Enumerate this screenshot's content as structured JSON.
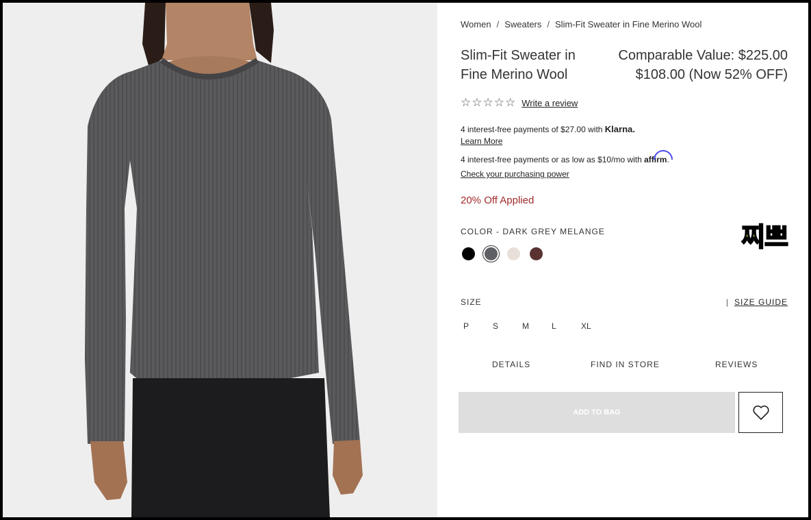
{
  "breadcrumb": {
    "items": [
      "Women",
      "Sweaters",
      "Slim-Fit Sweater in Fine Merino Wool"
    ],
    "separator": "/"
  },
  "product": {
    "name": "Slim-Fit Sweater in Fine Merino Wool",
    "comparable_value": "Comparable Value: $225.00",
    "sale_price": "$108.00 (Now 52% OFF)"
  },
  "rating": {
    "stars": "☆☆☆☆☆",
    "write_review": "Write a review"
  },
  "payments": {
    "klarna_text": "4 interest-free payments of $27.00 with ",
    "klarna_brand": "Klarna.",
    "klarna_link": "Learn More",
    "affirm_text": "4 interest-free payments or as low as $10/mo with ",
    "affirm_brand": "affirm",
    "affirm_suffix": ".",
    "affirm_link": "Check your purchasing power"
  },
  "discount_note": "20% Off Applied",
  "color": {
    "label": "COLOR -  DARK GREY MELANGE",
    "swatches": [
      {
        "name": "Black",
        "hex": "#000000"
      },
      {
        "name": "Dark Grey Melange",
        "hex": "#5f5f66"
      },
      {
        "name": "Ivory",
        "hex": "#e8e0d8"
      },
      {
        "name": "Brown",
        "hex": "#5a3232"
      }
    ],
    "selected": 1
  },
  "overlay_text": "찌쁘",
  "size": {
    "label": "SIZE",
    "guide_separator": "|",
    "guide_label": "SIZE GUIDE",
    "options": [
      "P",
      "S",
      "M",
      "L",
      "XL"
    ]
  },
  "tabs": {
    "details": "DETAILS",
    "find_in_store": "FIND IN STORE",
    "reviews": "REVIEWS"
  },
  "actions": {
    "add_to_bag": "ADD TO BAG",
    "wishlist_icon": "heart-icon"
  },
  "colors": {
    "discount": "#a12b2b",
    "button_disabled": "#dedede",
    "background": "#ffffff"
  }
}
